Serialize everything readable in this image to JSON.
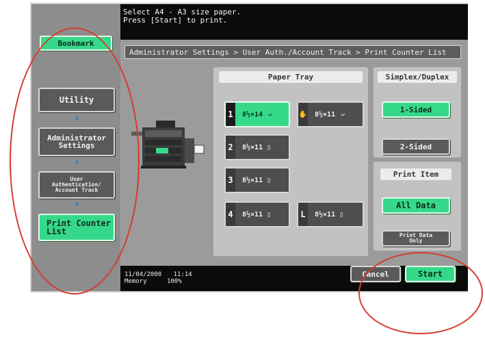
{
  "message": {
    "line1": "Select A4 - A3 size paper.",
    "line2": "Press [Start] to print."
  },
  "left_nav": {
    "bookmark": "Bookmark",
    "utility": "Utility",
    "admin_settings_line1": "Administrator",
    "admin_settings_line2": "Settings",
    "user_auth_line1": "User",
    "user_auth_line2": "Authentication/",
    "user_auth_line3": "Account Track",
    "print_counter_line1": "Print Counter",
    "print_counter_line2": "List",
    "arrow": "⬇"
  },
  "breadcrumb": "Administrator Settings > User Auth./Account Track > Print Counter List",
  "paper_tray": {
    "label": "Paper Tray",
    "trays": [
      {
        "num": "1",
        "size": "8½×14",
        "selected": true
      },
      {
        "num": "✋",
        "size": "8½×11",
        "selected": false
      },
      {
        "num": "2",
        "size": "8½×11",
        "selected": false
      },
      {
        "num": "3",
        "size": "8½×11",
        "selected": false
      },
      {
        "num": "4",
        "size": "8½×11",
        "selected": false
      },
      {
        "num": "L",
        "size": "8½×11",
        "selected": false
      }
    ]
  },
  "simplex": {
    "label": "Simplex/Duplex",
    "one_sided": "1-Sided",
    "two_sided": "2-Sided"
  },
  "print_item": {
    "label": "Print Item",
    "all_data": "All Data",
    "print_data_only_line1": "Print Data",
    "print_data_only_line2": "Only"
  },
  "status": {
    "date": "11/04/2008",
    "time": "11:14",
    "memory_label": "Memory",
    "memory_value": "100%"
  },
  "actions": {
    "cancel": "Cancel",
    "start": "Start"
  },
  "colors": {
    "green": "#36d98a",
    "annotation_red": "#d63a2e"
  }
}
